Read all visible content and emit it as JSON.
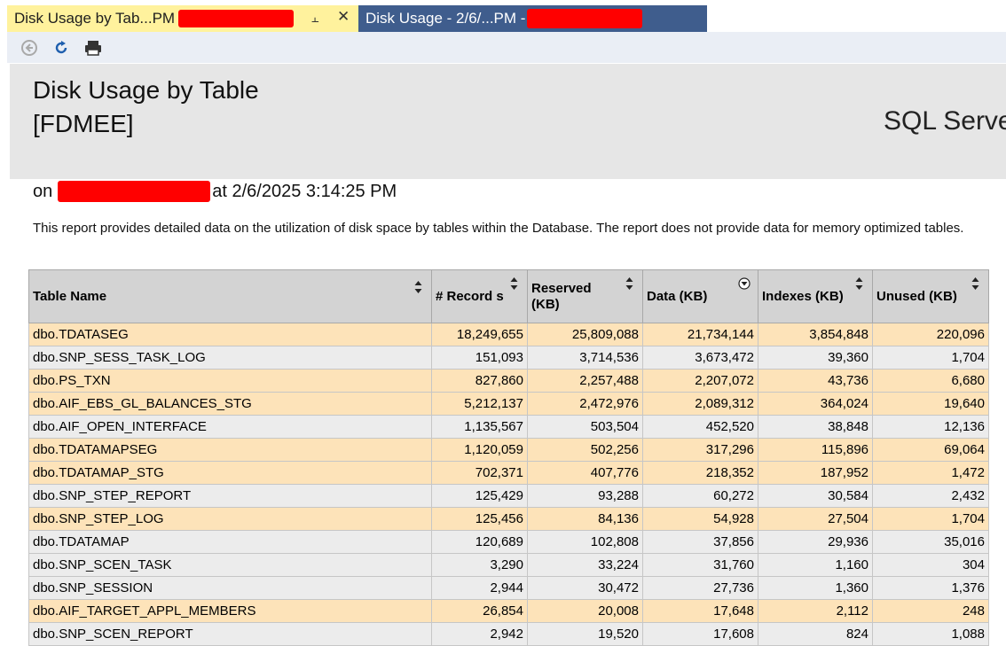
{
  "tabs": [
    {
      "title": "Disk Usage by Tab...PM",
      "active": true
    },
    {
      "title": "Disk Usage - 2/6/...PM - ",
      "active": false
    }
  ],
  "toolbar": {
    "back": "back-icon",
    "refresh": "refresh-icon",
    "print": "print-icon"
  },
  "report": {
    "title_line1": "Disk Usage by Table",
    "title_line2": "[FDMEE]",
    "brand": "SQL Serve",
    "subtitle_prefix": "on",
    "subtitle_suffix": "at 2/6/2025 3:14:25 PM",
    "description": "This report provides detailed data on the utilization of disk space by tables within the Database. The report does not provide data for memory optimized tables."
  },
  "table": {
    "columns": [
      "Table Name",
      "# Record s",
      "Reserved (KB)",
      "Data (KB)",
      "Indexes (KB)",
      "Unused (KB)"
    ],
    "rows": [
      [
        "dbo.TDATASEG",
        "18,249,655",
        "25,809,088",
        "21,734,144",
        "3,854,848",
        "220,096"
      ],
      [
        "dbo.SNP_SESS_TASK_LOG",
        "151,093",
        "3,714,536",
        "3,673,472",
        "39,360",
        "1,704"
      ],
      [
        "dbo.PS_TXN",
        "827,860",
        "2,257,488",
        "2,207,072",
        "43,736",
        "6,680"
      ],
      [
        "dbo.AIF_EBS_GL_BALANCES_STG",
        "5,212,137",
        "2,472,976",
        "2,089,312",
        "364,024",
        "19,640"
      ],
      [
        "dbo.AIF_OPEN_INTERFACE",
        "1,135,567",
        "503,504",
        "452,520",
        "38,848",
        "12,136"
      ],
      [
        "dbo.TDATAMAPSEG",
        "1,120,059",
        "502,256",
        "317,296",
        "115,896",
        "69,064"
      ],
      [
        "dbo.TDATAMAP_STG",
        "702,371",
        "407,776",
        "218,352",
        "187,952",
        "1,472"
      ],
      [
        "dbo.SNP_STEP_REPORT",
        "125,429",
        "93,288",
        "60,272",
        "30,584",
        "2,432"
      ],
      [
        "dbo.SNP_STEP_LOG",
        "125,456",
        "84,136",
        "54,928",
        "27,504",
        "1,704"
      ],
      [
        "dbo.TDATAMAP",
        "120,689",
        "102,808",
        "37,856",
        "29,936",
        "35,016"
      ],
      [
        "dbo.SNP_SCEN_TASK",
        "3,290",
        "33,224",
        "31,760",
        "1,160",
        "304"
      ],
      [
        "dbo.SNP_SESSION",
        "2,944",
        "30,472",
        "27,736",
        "1,360",
        "1,376"
      ],
      [
        "dbo.AIF_TARGET_APPL_MEMBERS",
        "26,854",
        "20,008",
        "17,648",
        "2,112",
        "248"
      ],
      [
        "dbo.SNP_SCEN_REPORT",
        "2,942",
        "19,520",
        "17,608",
        "824",
        "1,088"
      ]
    ],
    "row_shading": [
      "alt",
      "plain",
      "alt",
      "alt",
      "plain",
      "alt",
      "alt",
      "plain",
      "alt",
      "plain",
      "plain",
      "plain",
      "alt",
      "plain"
    ],
    "sorted_column": "Data (KB)",
    "sort_direction": "descending"
  },
  "colors": {
    "active_tab": "#fff29d",
    "inactive_tab": "#3f5d8d",
    "row_highlight": "#fde3b9",
    "row_plain": "#ececec",
    "header": "#d3d3d3"
  }
}
